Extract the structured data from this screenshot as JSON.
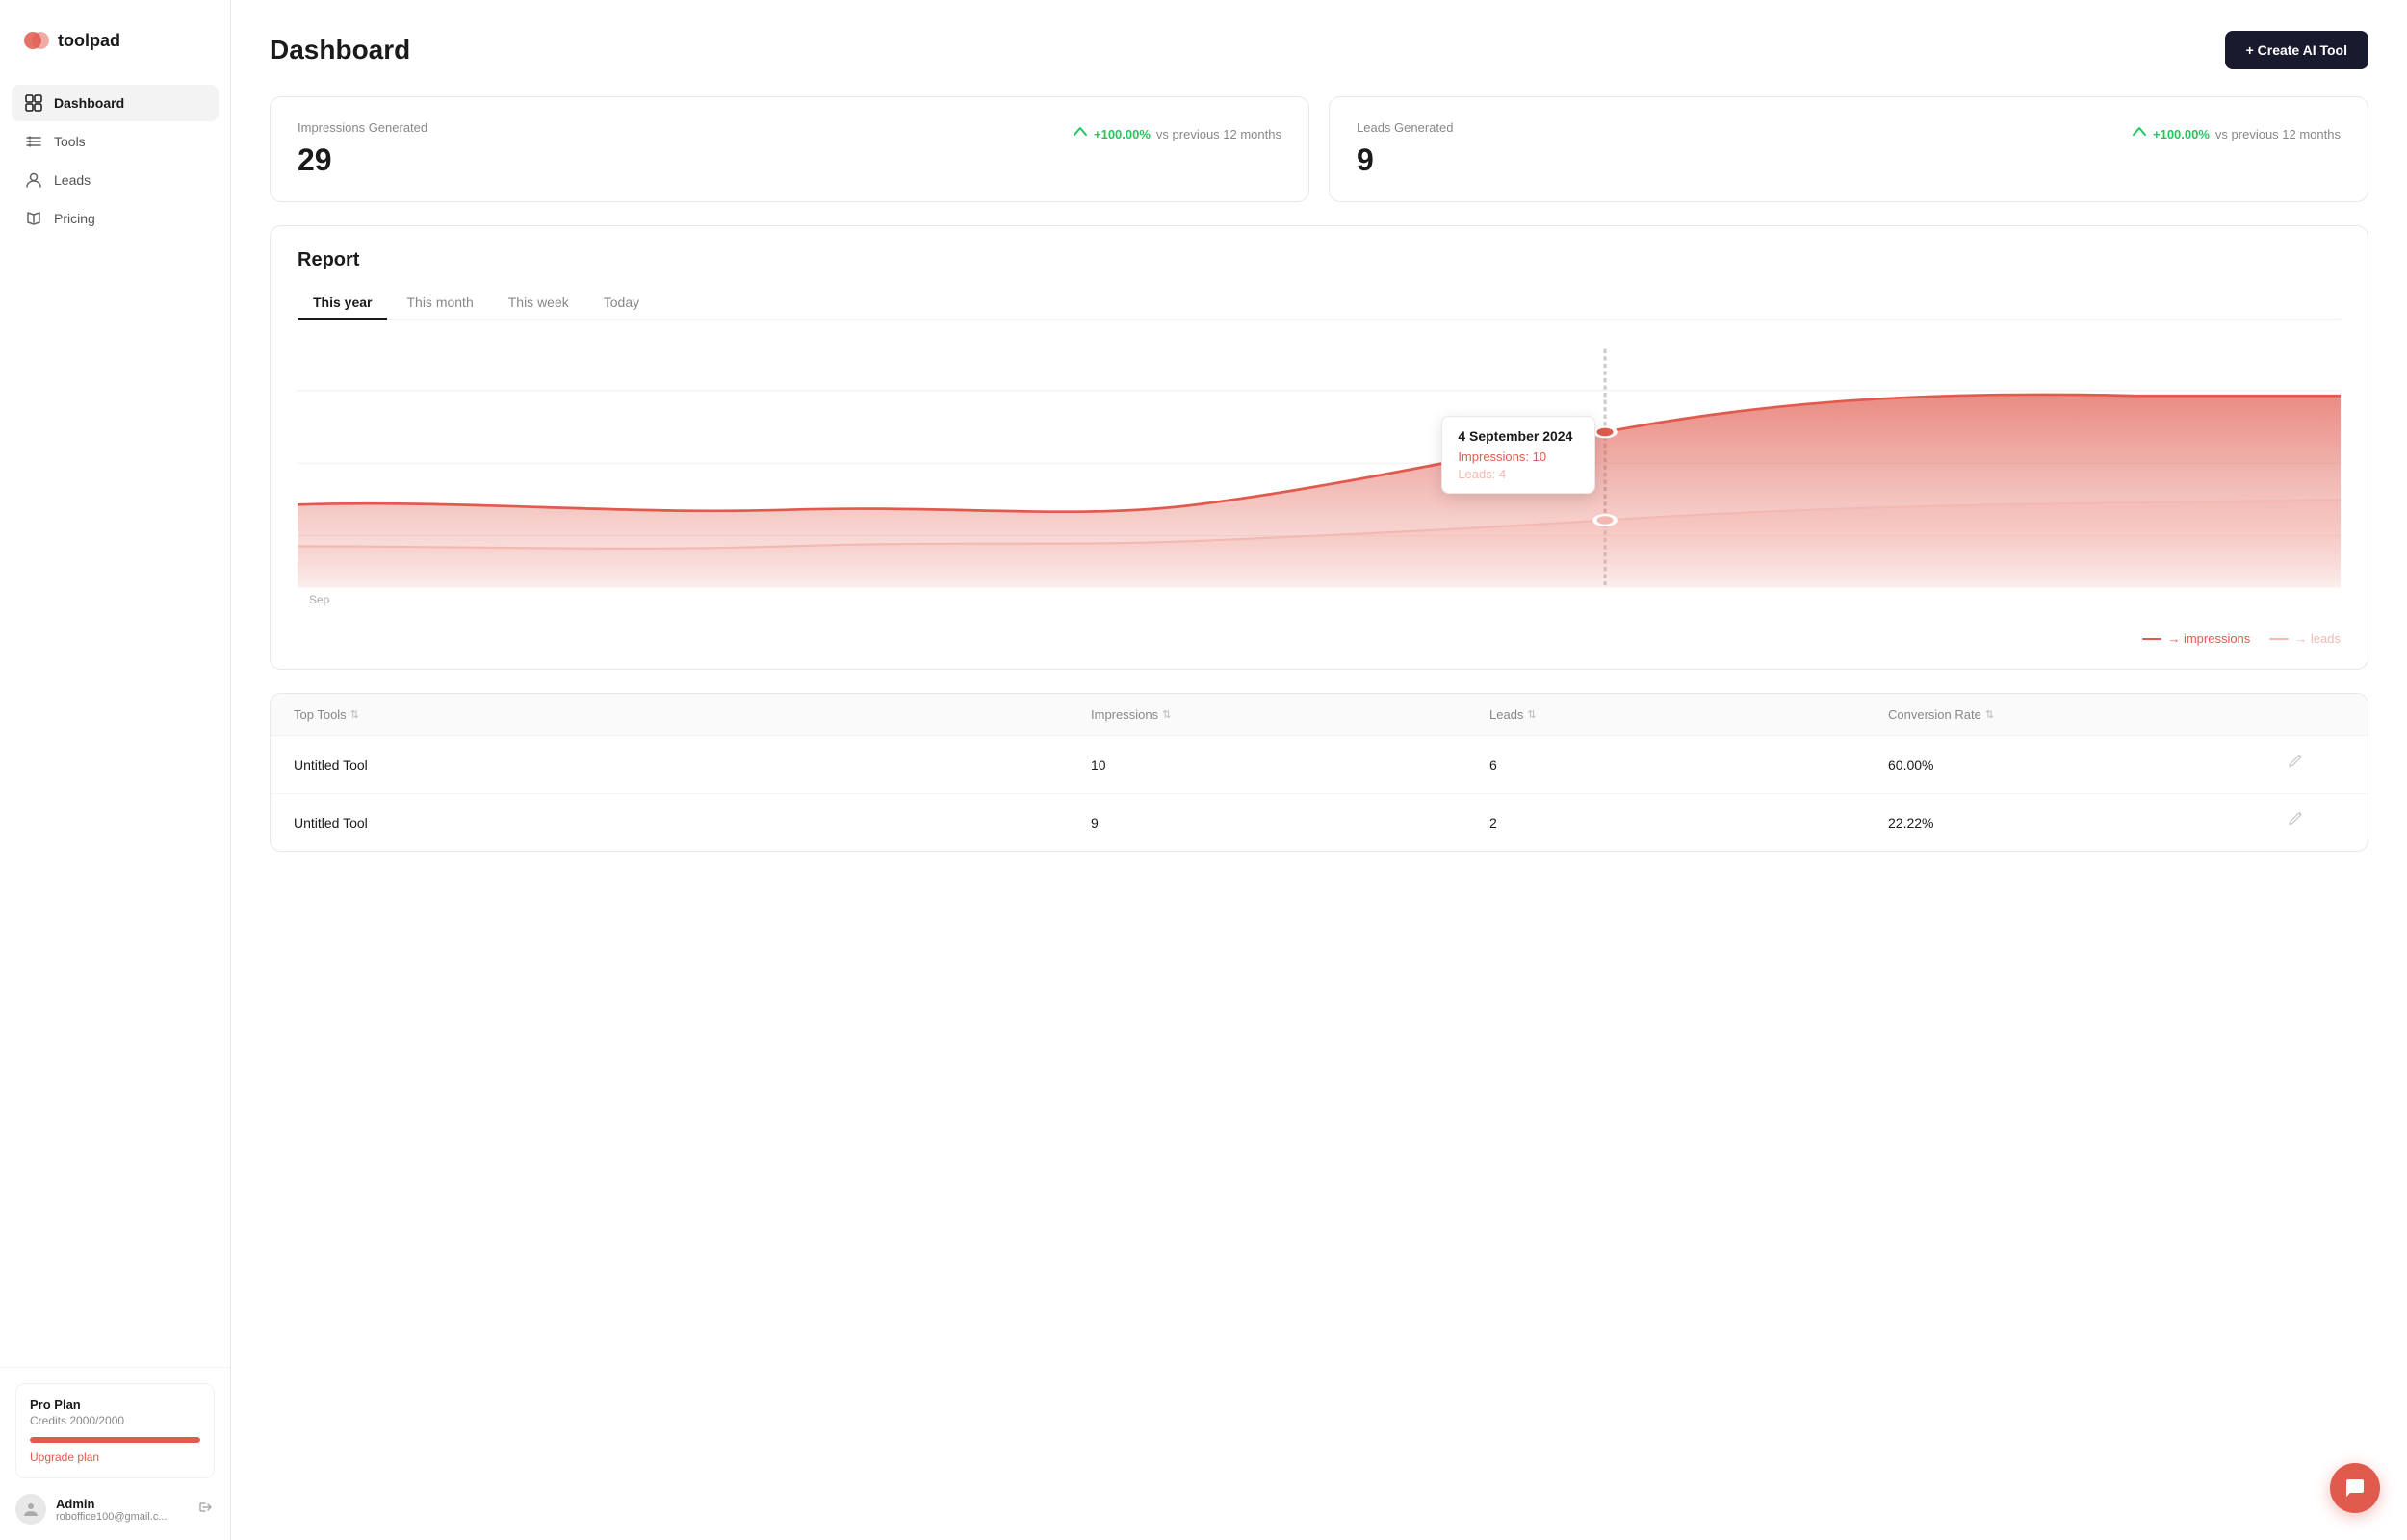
{
  "app": {
    "logo_text": "toolpad"
  },
  "sidebar": {
    "nav_items": [
      {
        "id": "dashboard",
        "label": "Dashboard",
        "active": true
      },
      {
        "id": "tools",
        "label": "Tools",
        "active": false
      },
      {
        "id": "leads",
        "label": "Leads",
        "active": false
      },
      {
        "id": "pricing",
        "label": "Pricing",
        "active": false
      }
    ],
    "plan": {
      "name": "Pro Plan",
      "credits_label": "Credits 2000/2000",
      "progress": 100,
      "upgrade_label": "Upgrade plan"
    },
    "user": {
      "name": "Admin",
      "email": "roboffice100@gmail.c..."
    }
  },
  "header": {
    "title": "Dashboard",
    "create_btn": "+ Create AI Tool"
  },
  "stats": {
    "impressions": {
      "label": "Impressions Generated",
      "value": "29",
      "change_pct": "+100.00%",
      "change_label": "vs previous 12 months"
    },
    "leads": {
      "label": "Leads Generated",
      "value": "9",
      "change_pct": "+100.00%",
      "change_label": "vs previous 12 months"
    }
  },
  "report": {
    "title": "Report",
    "tabs": [
      "This year",
      "This month",
      "This week",
      "Today"
    ],
    "active_tab": "This year",
    "x_label": "Sep",
    "tooltip": {
      "date": "4 September 2024",
      "impressions_label": "Impressions:",
      "impressions_value": "10",
      "leads_label": "Leads:",
      "leads_value": "4"
    },
    "legend": {
      "impressions": "impressions",
      "leads": "leads"
    }
  },
  "table": {
    "columns": [
      "Top Tools",
      "Impressions",
      "Leads",
      "Conversion Rate",
      ""
    ],
    "rows": [
      {
        "name": "Untitled Tool",
        "impressions": "10",
        "leads": "6",
        "conversion": "60.00%"
      },
      {
        "name": "Untitled Tool",
        "impressions": "9",
        "leads": "2",
        "conversion": "22.22%"
      }
    ]
  }
}
